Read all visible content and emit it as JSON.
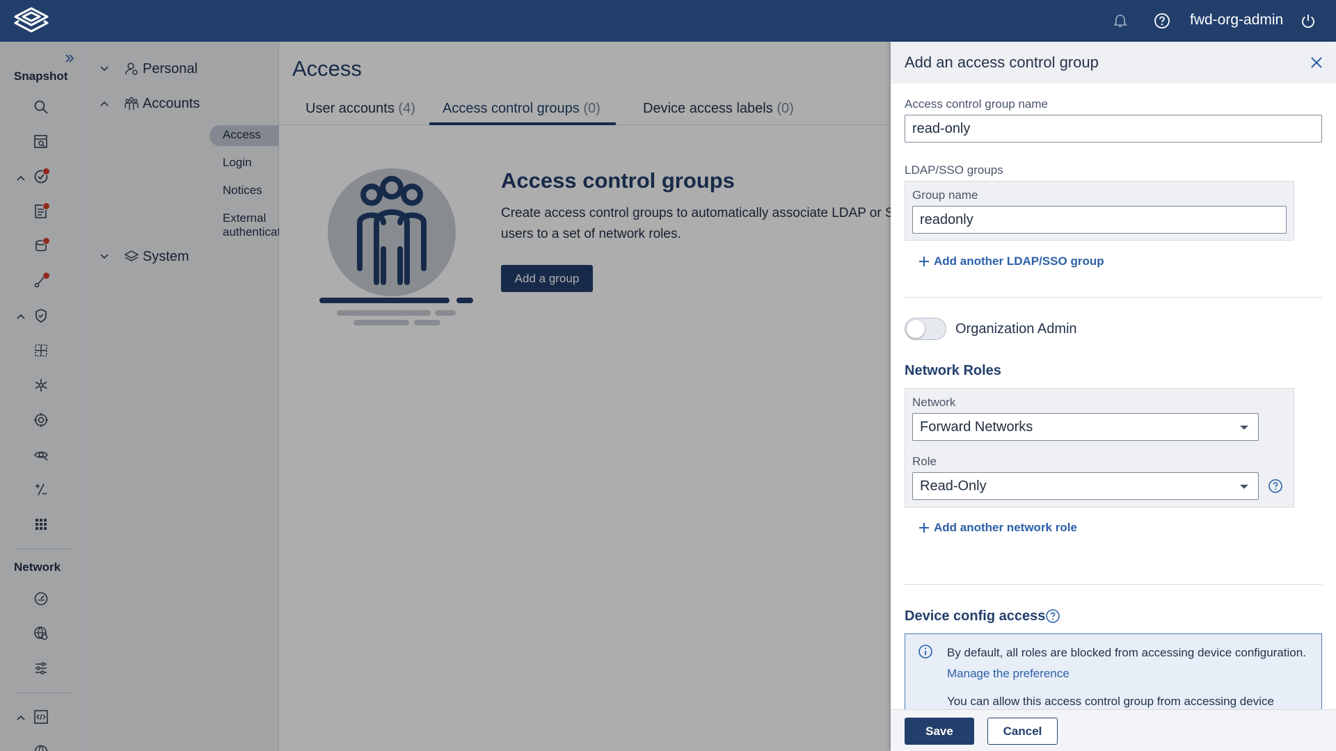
{
  "topbar": {
    "logo_icon": "forward-networks-logo",
    "notification_icon": "bell-icon",
    "help_icon": "help-circle-icon",
    "username": "fwd-org-admin",
    "power_icon": "power-icon"
  },
  "rail": {
    "snapshot_label": "Snapshot",
    "network_label": "Network"
  },
  "nav": {
    "personal": "Personal",
    "accounts": "Accounts",
    "items": [
      "Access",
      "Login",
      "Notices",
      "External authentication"
    ],
    "system": "System"
  },
  "main": {
    "title": "Access",
    "tabs": [
      {
        "label": "User accounts",
        "count": "(4)"
      },
      {
        "label": "Access control groups",
        "count": "(0)"
      },
      {
        "label": "Device access labels",
        "count": "(0)"
      }
    ],
    "empty_title": "Access control groups",
    "empty_desc_1": "Create access control groups to automatically associate LDAP or SSO",
    "empty_desc_2": "users to a set of network roles.",
    "add_button": "Add a group"
  },
  "drawer": {
    "title": "Add an access control group",
    "name_label": "Access control group name",
    "name_value": "read-only",
    "ldap_label": "LDAP/SSO groups",
    "group_name_label": "Group name",
    "group_name_value": "readonly",
    "add_ldap": "Add another LDAP/SSO group",
    "org_admin_label": "Organization Admin",
    "org_admin_on": false,
    "network_roles_heading": "Network Roles",
    "network_label": "Network",
    "network_value": "Forward Networks",
    "role_label": "Role",
    "role_value": "Read-Only",
    "add_role": "Add another network role",
    "device_config_heading": "Device config access",
    "info_text": "By default, all roles are blocked from accessing device configuration.",
    "info_link": "Manage the preference",
    "info_text2": "You can allow this access control group from accessing device",
    "save": "Save",
    "cancel": "Cancel"
  },
  "colors": {
    "brand": "#223f6c",
    "link": "#2c5fa8",
    "badge": "#d63d2f"
  }
}
